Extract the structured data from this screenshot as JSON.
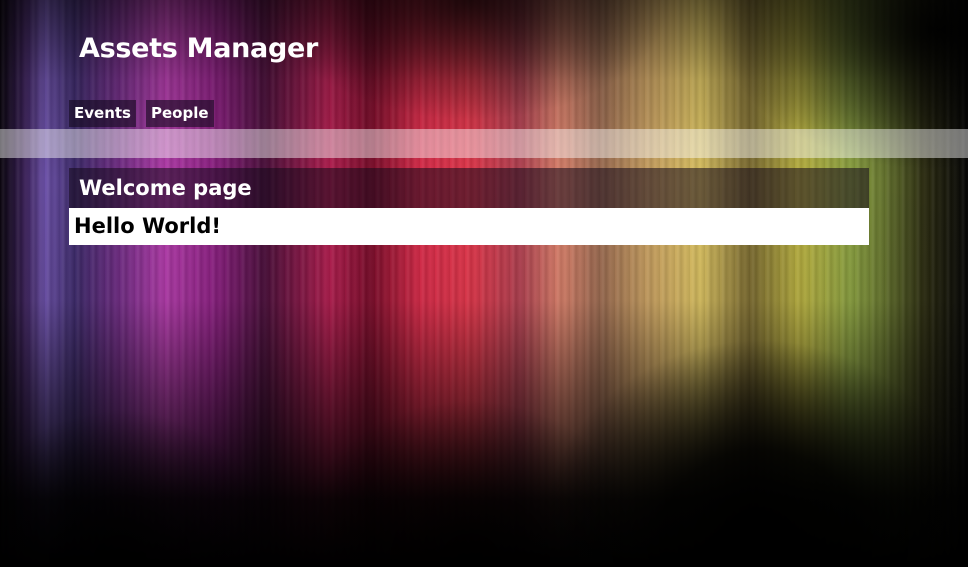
{
  "header": {
    "title": "Assets Manager"
  },
  "nav": {
    "items": [
      {
        "label": "Events"
      },
      {
        "label": "People"
      }
    ]
  },
  "main": {
    "heading": "Welcome page",
    "body_text": "Hello World!"
  },
  "theme": {
    "panel_body_bg": "#ffffff",
    "text_light": "#ffffff",
    "text_dark": "#000000"
  }
}
